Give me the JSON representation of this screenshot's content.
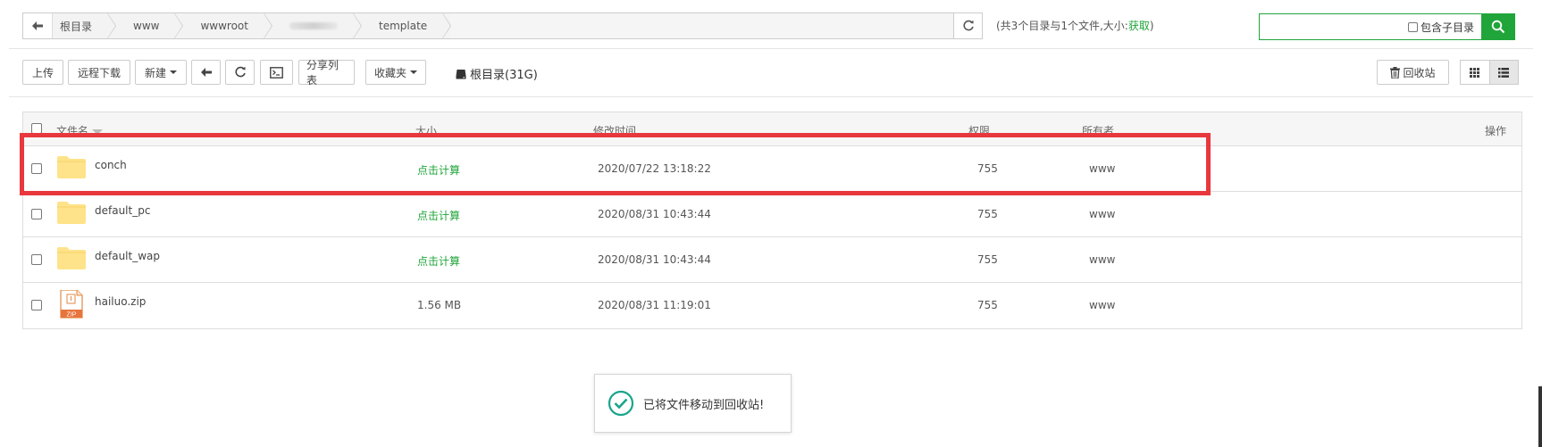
{
  "path": {
    "crumbs": [
      "根目录",
      "www",
      "wwwroot",
      "",
      "template"
    ]
  },
  "summary": {
    "text": "(共3个目录与1个文件,大小:",
    "link": "获取",
    "close": ")"
  },
  "search": {
    "placeholder": "",
    "subdir_label": "包含子目录"
  },
  "toolbar": {
    "upload": "上传",
    "remote_download": "远程下载",
    "new": "新建",
    "share_list": "分享列表",
    "favorites": "收藏夹",
    "disk_label": "根目录(31G)",
    "recycle": "回收站"
  },
  "table": {
    "headers": {
      "name": "文件名",
      "size": "大小",
      "modified": "修改时间",
      "perm": "权限",
      "owner": "所有者",
      "ops": "操作"
    },
    "rows": [
      {
        "name": "conch",
        "type": "folder",
        "size": "点击计算",
        "modified": "2020/07/22 13:18:22",
        "perm": "755",
        "owner": "www"
      },
      {
        "name": "default_pc",
        "type": "folder",
        "size": "点击计算",
        "modified": "2020/08/31 10:43:44",
        "perm": "755",
        "owner": "www"
      },
      {
        "name": "default_wap",
        "type": "folder",
        "size": "点击计算",
        "modified": "2020/08/31 10:43:44",
        "perm": "755",
        "owner": "www"
      },
      {
        "name": "hailuo.zip",
        "type": "zip",
        "size": "1.56 MB",
        "modified": "2020/08/31 11:19:01",
        "perm": "755",
        "owner": "www"
      }
    ]
  },
  "toast": {
    "message": "已将文件移动到回收站!"
  },
  "colors": {
    "accent": "#20a53a",
    "highlight": "#e8383d",
    "folder": "#ffe38a"
  }
}
